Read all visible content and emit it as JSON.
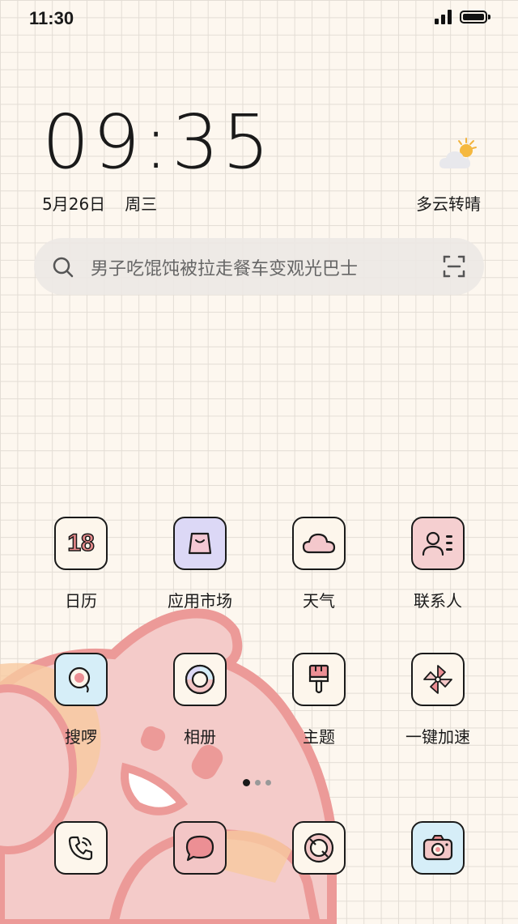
{
  "status_bar": {
    "time": "11:30",
    "battery_percent": 100,
    "signal_bars": 3
  },
  "clock_widget": {
    "time": "09:35",
    "date": "5月26日",
    "weekday": "周三",
    "weather_icon": "partly-cloudy-sun-icon",
    "weather": "多云转晴"
  },
  "search": {
    "placeholder": "男子吃馄饨被拉走餐车变观光巴士",
    "search_icon": "search-icon",
    "scan_icon": "scan-icon"
  },
  "apps_row1": [
    {
      "label": "日历",
      "icon": "calendar-icon",
      "icon_text": "18"
    },
    {
      "label": "应用市场",
      "icon": "app-store-icon"
    },
    {
      "label": "天气",
      "icon": "weather-cloud-icon"
    },
    {
      "label": "联系人",
      "icon": "contacts-icon"
    }
  ],
  "apps_row2": [
    {
      "label": "搜啰",
      "icon": "search-app-icon"
    },
    {
      "label": "相册",
      "icon": "gallery-icon"
    },
    {
      "label": "主题",
      "icon": "theme-brush-icon"
    },
    {
      "label": "一键加速",
      "icon": "pinwheel-boost-icon"
    }
  ],
  "page_indicator": {
    "pages": 3,
    "current": 1
  },
  "dock": [
    {
      "icon": "phone-icon"
    },
    {
      "icon": "messages-icon"
    },
    {
      "icon": "browser-icon"
    },
    {
      "icon": "camera-icon"
    }
  ],
  "colors": {
    "background": "#fdf7ef",
    "pink": "#f3c6c6",
    "pink_dark": "#e8898a",
    "peach": "#f7c9a0",
    "blue": "#d6eef8",
    "lavender": "#dcd8f6"
  }
}
